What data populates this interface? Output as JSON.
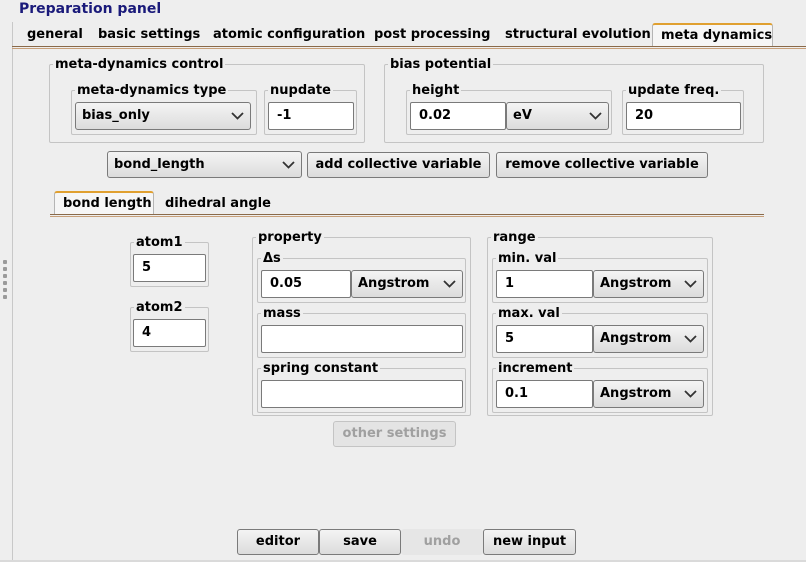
{
  "title": "Preparation panel",
  "main_tabs": [
    "general",
    "basic settings",
    "atomic configuration",
    "post processing",
    "structural evolution",
    "meta dynamics"
  ],
  "meta_control": {
    "legend": "meta-dynamics control",
    "type_legend": "meta-dynamics type",
    "type_value": "bias_only",
    "nupdate_legend": "nupdate",
    "nupdate_value": "-1"
  },
  "bias_potential": {
    "legend": "bias potential",
    "height_legend": "height",
    "height_value": "0.02",
    "height_unit": "eV",
    "update_legend": "update freq.",
    "update_value": "20"
  },
  "cv_bar": {
    "selected": "bond_length",
    "add_label": "add collective variable",
    "remove_label": "remove collective variable"
  },
  "cv_tabs": [
    "bond length",
    "dihedral angle"
  ],
  "atoms": {
    "atom1_legend": "atom1",
    "atom1_value": "5",
    "atom2_legend": "atom2",
    "atom2_value": "4"
  },
  "property": {
    "legend": "property",
    "ds_legend": "Δs",
    "ds_value": "0.05",
    "ds_unit": "Angstrom",
    "mass_legend": "mass",
    "mass_value": "",
    "spring_legend": "spring constant",
    "spring_value": "",
    "other_label": "other settings"
  },
  "range": {
    "legend": "range",
    "min_legend": "min. val",
    "min_value": "1",
    "min_unit": "Angstrom",
    "max_legend": "max. val",
    "max_value": "5",
    "max_unit": "Angstrom",
    "inc_legend": "increment",
    "inc_value": "0.1",
    "inc_unit": "Angstrom"
  },
  "bottom": {
    "editor": "editor",
    "save": "save",
    "undo": "undo",
    "new_input": "new input"
  }
}
